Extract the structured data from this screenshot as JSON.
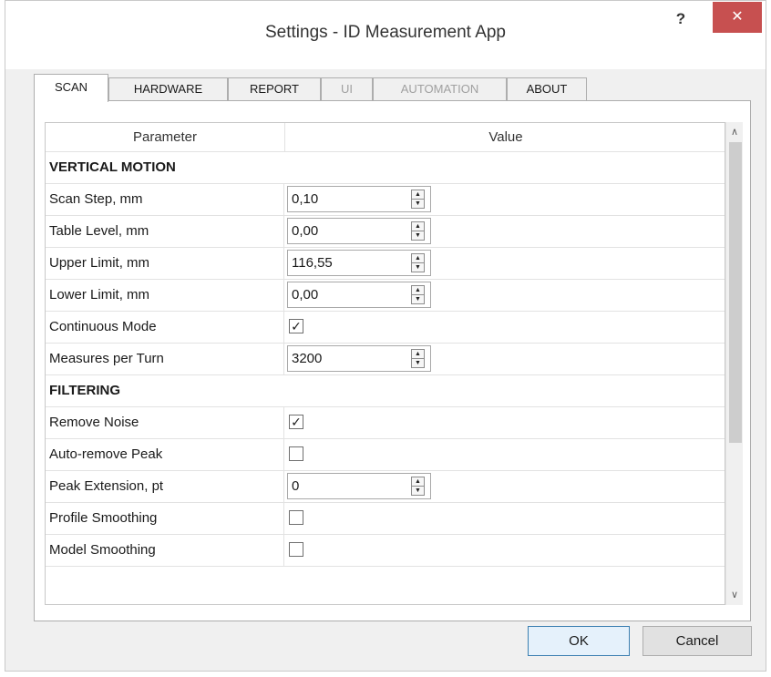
{
  "window": {
    "title": "Settings - ID Measurement App",
    "help_label": "?",
    "close_label": "✕"
  },
  "tabs": [
    {
      "label": "SCAN",
      "active": true,
      "enabled": true
    },
    {
      "label": "HARDWARE",
      "active": false,
      "enabled": true
    },
    {
      "label": "REPORT",
      "active": false,
      "enabled": true
    },
    {
      "label": "UI",
      "active": false,
      "enabled": false
    },
    {
      "label": "AUTOMATION",
      "active": false,
      "enabled": false
    },
    {
      "label": "ABOUT",
      "active": false,
      "enabled": true
    }
  ],
  "grid": {
    "headers": {
      "parameter": "Parameter",
      "value": "Value"
    },
    "sections": [
      {
        "title": "VERTICAL MOTION"
      },
      {
        "title": "FILTERING"
      }
    ],
    "rows": [
      {
        "label": "Scan Step, mm",
        "value": "0,10"
      },
      {
        "label": "Table Level, mm",
        "value": "0,00"
      },
      {
        "label": "Upper Limit, mm",
        "value": "116,55"
      },
      {
        "label": "Lower Limit, mm",
        "value": "0,00"
      },
      {
        "label": "Continuous Mode",
        "checked": true
      },
      {
        "label": "Measures per Turn",
        "value": "3200"
      },
      {
        "label": "Remove Noise",
        "checked": true
      },
      {
        "label": "Auto-remove Peak",
        "checked": false
      },
      {
        "label": "Peak Extension, pt",
        "value": "0"
      },
      {
        "label": "Profile Smoothing",
        "checked": false
      },
      {
        "label": "Model Smoothing",
        "checked": false
      }
    ]
  },
  "icons": {
    "spin_up": "▲",
    "spin_down": "▼",
    "check_mark": "✓",
    "scroll_up": "∧",
    "scroll_down": "∨"
  },
  "buttons": {
    "ok_label": "OK",
    "cancel_label": "Cancel"
  },
  "colors": {
    "close_button": "#c75050",
    "ok_border": "#3c7fb1"
  }
}
